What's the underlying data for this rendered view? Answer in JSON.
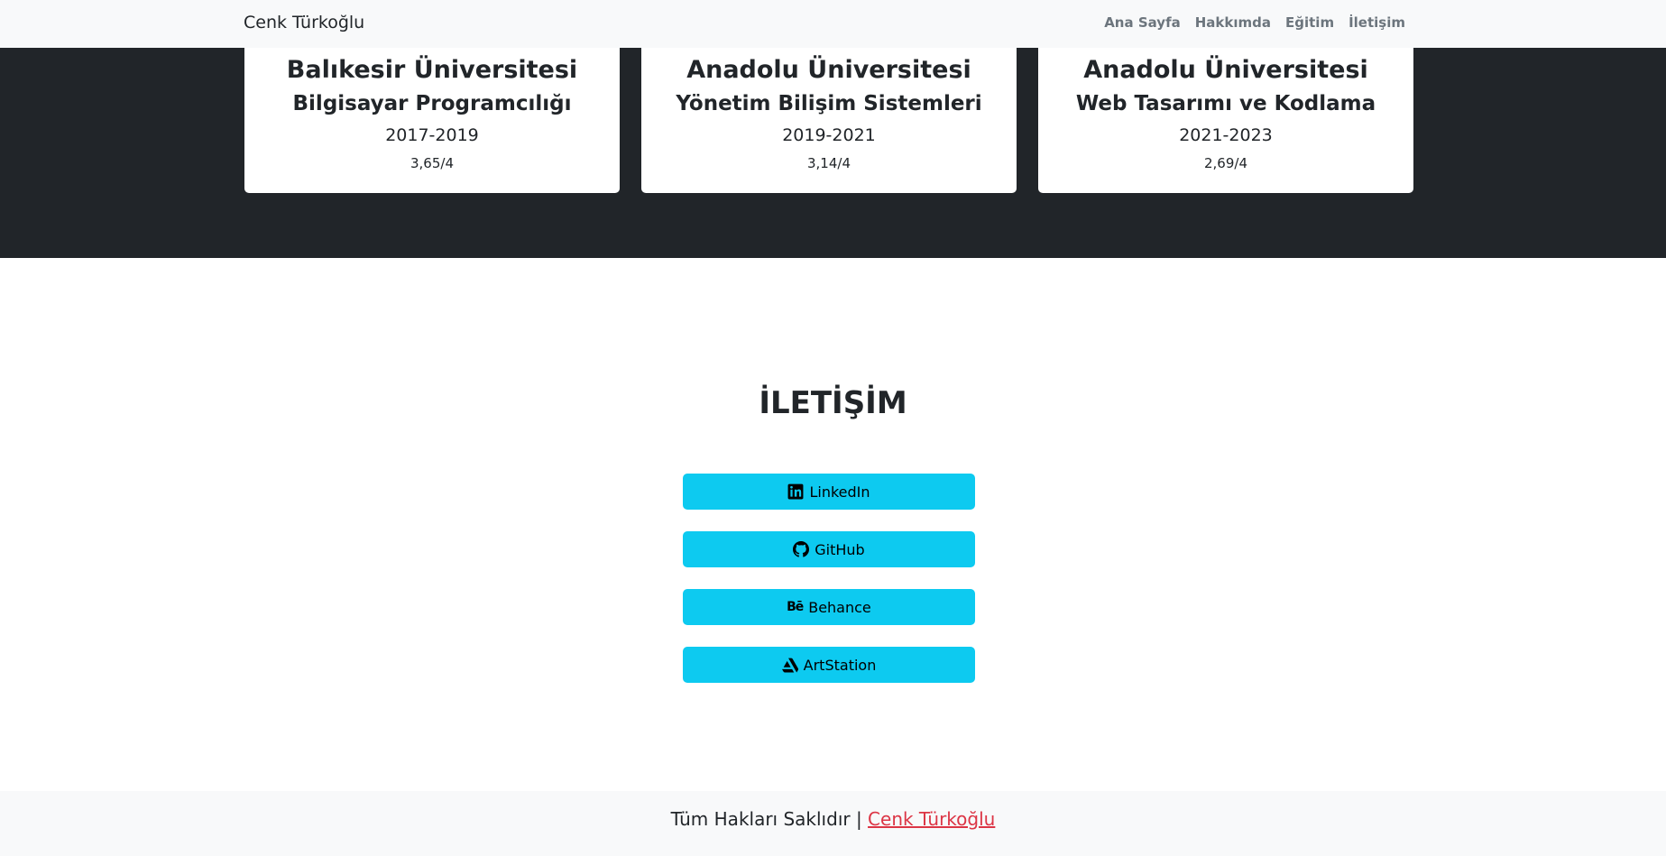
{
  "navbar": {
    "brand": "Cenk Türkoğlu",
    "links": [
      "Ana Sayfa",
      "Hakkımda",
      "Eğitim",
      "İletişim"
    ]
  },
  "education": {
    "cards": [
      {
        "school": "Balıkesir Üniversitesi",
        "department": "Bilgisayar Programcılığı",
        "years": "2017-2019",
        "gpa": "3,65/4"
      },
      {
        "school": "Anadolu Üniversitesi",
        "department": "Yönetim Bilişim Sistemleri",
        "years": "2019-2021",
        "gpa": "3,14/4"
      },
      {
        "school": "Anadolu Üniversitesi",
        "department": "Web Tasarımı ve Kodlama",
        "years": "2021-2023",
        "gpa": "2,69/4"
      }
    ]
  },
  "contact": {
    "title": "İLETİŞİM",
    "buttons": [
      {
        "label": "LinkedIn",
        "icon": "linkedin-icon"
      },
      {
        "label": "GitHub",
        "icon": "github-icon"
      },
      {
        "label": "Behance",
        "icon": "behance-icon"
      },
      {
        "label": "ArtStation",
        "icon": "artstation-icon"
      }
    ]
  },
  "footer": {
    "text": "Tüm Hakları Saklıdır |",
    "link": "Cenk Türkoğlu"
  },
  "colors": {
    "navbar_bg": "#f8f9fa",
    "dark_section": "#212529",
    "button": "#0dcaf0",
    "footer_link": "#dc3545"
  }
}
